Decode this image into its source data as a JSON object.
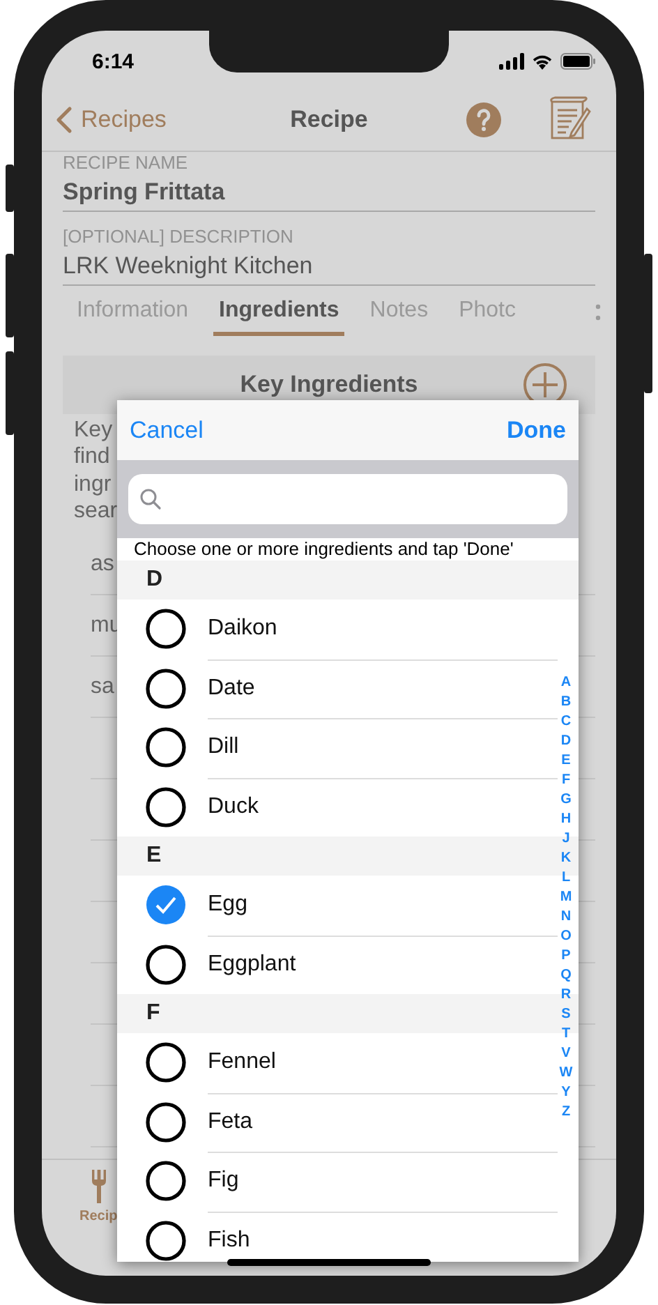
{
  "status_bar": {
    "time": "6:14"
  },
  "nav": {
    "back": "Recipes",
    "title": "Recipe"
  },
  "fields": [
    {
      "label": "RECIPE NAME",
      "value": "Spring Frittata",
      "bold": true
    },
    {
      "label": "[OPTIONAL] DESCRIPTION",
      "value": "LRK Weeknight Kitchen",
      "bold": false
    }
  ],
  "tabs": [
    {
      "label": "Information",
      "selected": false
    },
    {
      "label": "Ingredients",
      "selected": true
    },
    {
      "label": "Notes",
      "selected": false
    },
    {
      "label": "Photc",
      "selected": false
    }
  ],
  "section": {
    "title": "Key Ingredients"
  },
  "intro_lines": [
    "Key",
    "find",
    "ingr",
    "sear"
  ],
  "ingredient_rows": [
    "as",
    "mu",
    "sa"
  ],
  "tab_bar": {
    "items": [
      {
        "label": "Recip",
        "selected": true
      }
    ]
  },
  "picker": {
    "cancel": "Cancel",
    "done": "Done",
    "hint": "Choose one or more ingredients and tap 'Done'",
    "sections": [
      {
        "letter": "D",
        "items": [
          {
            "name": "Daikon",
            "checked": false
          },
          {
            "name": "Date",
            "checked": false
          },
          {
            "name": "Dill",
            "checked": false
          },
          {
            "name": "Duck",
            "checked": false
          }
        ]
      },
      {
        "letter": "E",
        "items": [
          {
            "name": "Egg",
            "checked": true
          },
          {
            "name": "Eggplant",
            "checked": false
          }
        ]
      },
      {
        "letter": "F",
        "items": [
          {
            "name": "Fennel",
            "checked": false
          },
          {
            "name": "Feta",
            "checked": false
          },
          {
            "name": "Fig",
            "checked": false
          },
          {
            "name": "Fish",
            "checked": false
          }
        ]
      }
    ],
    "index": [
      "A",
      "B",
      "C",
      "D",
      "E",
      "F",
      "G",
      "H",
      "J",
      "K",
      "L",
      "M",
      "N",
      "O",
      "P",
      "Q",
      "R",
      "S",
      "T",
      "V",
      "W",
      "Y",
      "Z"
    ]
  }
}
